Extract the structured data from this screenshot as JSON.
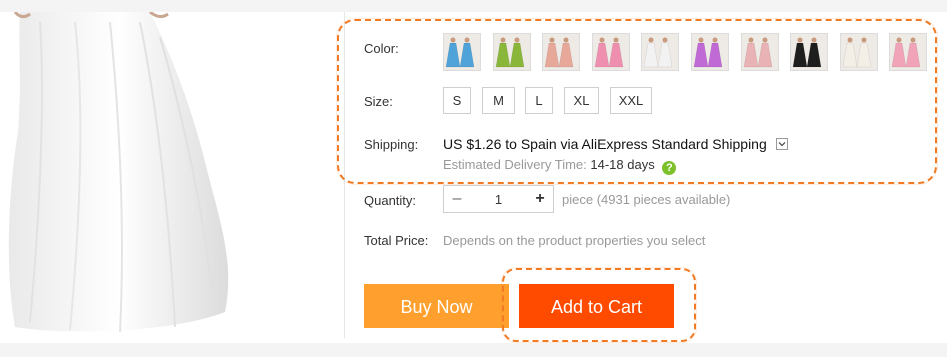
{
  "options": {
    "color_label": "Color:",
    "size_label": "Size:",
    "shipping_label": "Shipping:",
    "colors": [
      {
        "name": "sky-blue",
        "hex": "#4fa3d8"
      },
      {
        "name": "green",
        "hex": "#8ab63a"
      },
      {
        "name": "peach",
        "hex": "#e7a89a"
      },
      {
        "name": "pink",
        "hex": "#ef8fb0"
      },
      {
        "name": "white",
        "hex": "#f2f2f2"
      },
      {
        "name": "purple",
        "hex": "#c06ad6"
      },
      {
        "name": "blush",
        "hex": "#e9b2b4"
      },
      {
        "name": "black",
        "hex": "#1e1e1e"
      },
      {
        "name": "ivory",
        "hex": "#f4efe6"
      },
      {
        "name": "light-pink",
        "hex": "#f1a3b7"
      }
    ],
    "sizes": [
      "S",
      "M",
      "L",
      "XL",
      "XXL"
    ]
  },
  "shipping": {
    "line": "US $1.26 to Spain via AliExpress Standard Shipping",
    "dropdown_icon": "chevron-down-icon",
    "eta_label": "Estimated Delivery Time:",
    "eta_days": "14-18 days",
    "help_icon": "?"
  },
  "quantity": {
    "label": "Quantity:",
    "minus": "–",
    "value": "1",
    "plus": "+",
    "available": "piece (4931 pieces available)"
  },
  "total": {
    "label": "Total Price:",
    "note": "Depends on the product properties you select"
  },
  "actions": {
    "buy_now": "Buy Now",
    "add_to_cart": "Add to Cart"
  },
  "colors": {
    "buy_now_bg": "#ffa02e",
    "add_to_cart_bg": "#ff4b00",
    "highlight": "#f07b24"
  }
}
